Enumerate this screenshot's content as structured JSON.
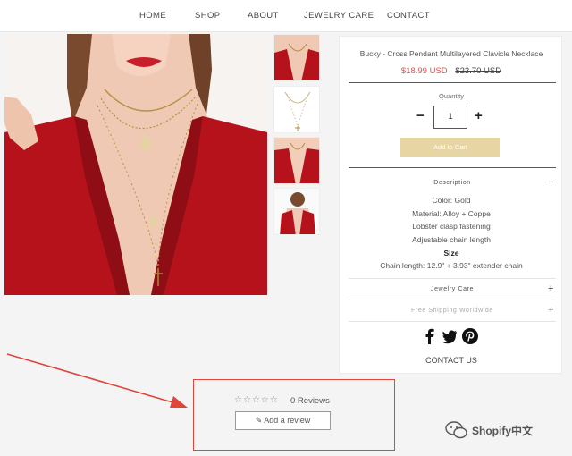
{
  "nav": {
    "items": [
      "HOME",
      "SHOP",
      "ABOUT",
      "JEWELRY CARE",
      "CONTACT"
    ]
  },
  "product": {
    "title": "Bucky - Cross Pendant Multilayered Clavicle Necklace",
    "sale_price": "$18.99 USD",
    "original_price": "$23.70 USD",
    "quantity_label": "Quantity",
    "quantity": "1",
    "add_to_cart": "Add to Cart",
    "accent_color": "#e7d6a3",
    "sale_color": "#d9534f"
  },
  "description": {
    "heading": "Description",
    "toggle": "−",
    "lines": [
      "Color: Gold",
      "Material: Alloy + Coppe",
      "Lobster clasp fastening",
      "Adjustable chain length"
    ],
    "size_heading": "Size",
    "size_text": "Chain length: 12.9\" + 3.93\" extender chain"
  },
  "sections": {
    "jewelry_care": "Jewelry Care",
    "jewelry_care_toggle": "+",
    "shipping": "Free Shipping Worldwide",
    "shipping_toggle": "+"
  },
  "social": [
    "facebook-icon",
    "twitter-icon",
    "pinterest-icon"
  ],
  "contact_link": "CONTACT US",
  "reviews": {
    "stars": "☆☆☆☆☆",
    "count_text": "0 Reviews",
    "add_review": "Add a review"
  },
  "watermark": {
    "text": "Shopify中文"
  },
  "highlight_color": "#e0453a"
}
